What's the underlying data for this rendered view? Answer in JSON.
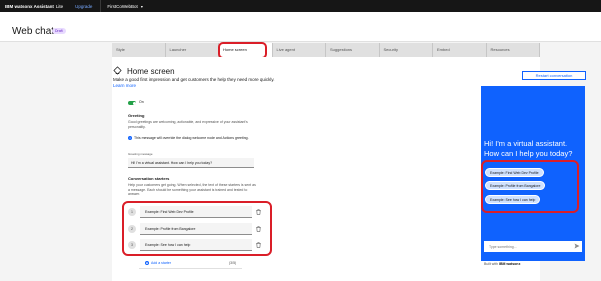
{
  "topbar": {
    "brand": "IBM watsonx Assistant",
    "plan": "Lite",
    "upgrade": "Upgrade",
    "bot_name": "FirstCoWebBot"
  },
  "page": {
    "title": "Web chat",
    "badge": "Draft"
  },
  "tabs": [
    {
      "label": "Style"
    },
    {
      "label": "Launcher"
    },
    {
      "label": "Home screen"
    },
    {
      "label": "Live agent"
    },
    {
      "label": "Suggestions"
    },
    {
      "label": "Security"
    },
    {
      "label": "Embed"
    },
    {
      "label": "Resources"
    }
  ],
  "active_tab": "Home screen",
  "home": {
    "title": "Home screen",
    "intro": "Make a good first impression and get customers the help they need more quickly.",
    "learn_more": "Learn more",
    "toggle_label": "On",
    "greeting": {
      "heading": "Greeting",
      "description": "Good greetings are welcoming, actionable, and expressive of your assistant's personality.",
      "info": "This message will override the dialog welcome node and Actions greeting.",
      "field_label": "Greeting message",
      "value": "Hi! I'm a virtual assistant. How can I help you today?"
    },
    "starters": {
      "heading": "Conversation starters",
      "description": "Help your customers get going. When selected, the text of these starters is sent as a message. Each should be something your assistant is trained and tested to answer.",
      "items": [
        {
          "num": "1",
          "text": "Example: Find Web Dev Profile"
        },
        {
          "num": "2",
          "text": "Example: Profile from Bangalore"
        },
        {
          "num": "3",
          "text": "Example: See how I can help"
        }
      ],
      "add_label": "Add a starter",
      "count": "(3/5)"
    }
  },
  "preview": {
    "restart_label": "Restart conversation",
    "greeting_line1": "Hi! I'm a virtual assistant.",
    "greeting_line2": "How can I help you today?",
    "chips": [
      "Example: Find Web Dev Profile",
      "Example: Profile from Bangalore",
      "Example: See how I can help"
    ],
    "input_placeholder": "Type something...",
    "built_with_prefix": "Built with",
    "built_with_brand": "IBM watsonx"
  },
  "colors": {
    "accent": "#0f62fe",
    "highlight_ring": "#da1e28",
    "toggle_on": "#24a148"
  }
}
